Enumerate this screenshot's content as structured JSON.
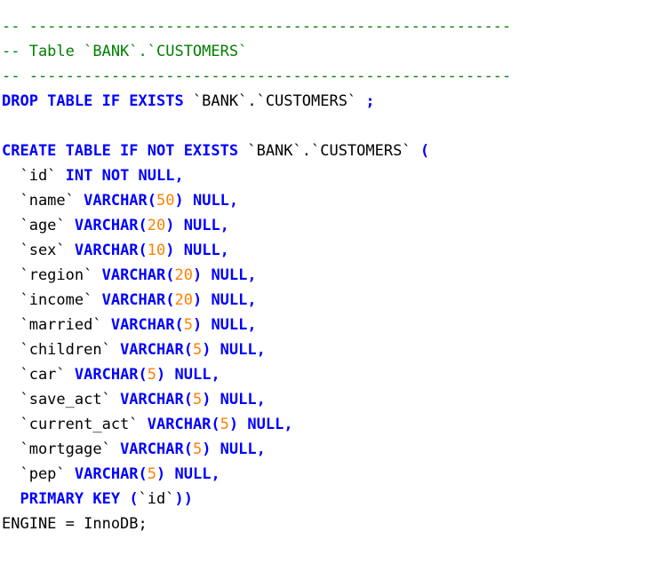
{
  "editor": {
    "language": "SQL",
    "colors": {
      "comment": "#008000",
      "keyword": "#0000FF",
      "number": "#FF8000",
      "text": "#000000",
      "background": "#FFFFFF"
    },
    "lines": [
      [
        {
          "t": "cmt",
          "v": "-- -----------------------------------------------------"
        }
      ],
      [
        {
          "t": "cmt",
          "v": "-- Table `BANK`.`CUSTOMERS`"
        }
      ],
      [
        {
          "t": "cmt",
          "v": "-- -----------------------------------------------------"
        }
      ],
      [
        {
          "t": "kw",
          "v": "DROP TABLE IF EXISTS"
        },
        {
          "t": "txt",
          "v": " `BANK`.`CUSTOMERS` "
        },
        {
          "t": "kw",
          "v": ";"
        }
      ],
      [],
      [
        {
          "t": "kw",
          "v": "CREATE TABLE IF NOT EXISTS"
        },
        {
          "t": "txt",
          "v": " `BANK`.`CUSTOMERS` "
        },
        {
          "t": "kw",
          "v": "("
        }
      ],
      [
        {
          "t": "txt",
          "v": "  `id` "
        },
        {
          "t": "kw",
          "v": "INT NOT NULL,"
        }
      ],
      [
        {
          "t": "txt",
          "v": "  `name` "
        },
        {
          "t": "kw",
          "v": "VARCHAR("
        },
        {
          "t": "num",
          "v": "50"
        },
        {
          "t": "kw",
          "v": ") NULL,"
        }
      ],
      [
        {
          "t": "txt",
          "v": "  `age` "
        },
        {
          "t": "kw",
          "v": "VARCHAR("
        },
        {
          "t": "num",
          "v": "20"
        },
        {
          "t": "kw",
          "v": ") NULL,"
        }
      ],
      [
        {
          "t": "txt",
          "v": "  `sex` "
        },
        {
          "t": "kw",
          "v": "VARCHAR("
        },
        {
          "t": "num",
          "v": "10"
        },
        {
          "t": "kw",
          "v": ") NULL,"
        }
      ],
      [
        {
          "t": "txt",
          "v": "  `region` "
        },
        {
          "t": "kw",
          "v": "VARCHAR("
        },
        {
          "t": "num",
          "v": "20"
        },
        {
          "t": "kw",
          "v": ") NULL,"
        }
      ],
      [
        {
          "t": "txt",
          "v": "  `income` "
        },
        {
          "t": "kw",
          "v": "VARCHAR("
        },
        {
          "t": "num",
          "v": "20"
        },
        {
          "t": "kw",
          "v": ") NULL,"
        }
      ],
      [
        {
          "t": "txt",
          "v": "  `married` "
        },
        {
          "t": "kw",
          "v": "VARCHAR("
        },
        {
          "t": "num",
          "v": "5"
        },
        {
          "t": "kw",
          "v": ") NULL,"
        }
      ],
      [
        {
          "t": "txt",
          "v": "  `children` "
        },
        {
          "t": "kw",
          "v": "VARCHAR("
        },
        {
          "t": "num",
          "v": "5"
        },
        {
          "t": "kw",
          "v": ") NULL,"
        }
      ],
      [
        {
          "t": "txt",
          "v": "  `car` "
        },
        {
          "t": "kw",
          "v": "VARCHAR("
        },
        {
          "t": "num",
          "v": "5"
        },
        {
          "t": "kw",
          "v": ") NULL,"
        }
      ],
      [
        {
          "t": "txt",
          "v": "  `save_act` "
        },
        {
          "t": "kw",
          "v": "VARCHAR("
        },
        {
          "t": "num",
          "v": "5"
        },
        {
          "t": "kw",
          "v": ") NULL,"
        }
      ],
      [
        {
          "t": "txt",
          "v": "  `current_act` "
        },
        {
          "t": "kw",
          "v": "VARCHAR("
        },
        {
          "t": "num",
          "v": "5"
        },
        {
          "t": "kw",
          "v": ") NULL,"
        }
      ],
      [
        {
          "t": "txt",
          "v": "  `mortgage` "
        },
        {
          "t": "kw",
          "v": "VARCHAR("
        },
        {
          "t": "num",
          "v": "5"
        },
        {
          "t": "kw",
          "v": ") NULL,"
        }
      ],
      [
        {
          "t": "txt",
          "v": "  `pep` "
        },
        {
          "t": "kw",
          "v": "VARCHAR("
        },
        {
          "t": "num",
          "v": "5"
        },
        {
          "t": "kw",
          "v": ") NULL,"
        }
      ],
      [
        {
          "t": "kw",
          "v": "  PRIMARY KEY"
        },
        {
          "t": "txt",
          "v": " "
        },
        {
          "t": "kw",
          "v": "("
        },
        {
          "t": "txt",
          "v": "`id`"
        },
        {
          "t": "kw",
          "v": "))"
        }
      ],
      [
        {
          "t": "txt",
          "v": "ENGINE = InnoDB;"
        }
      ]
    ]
  }
}
